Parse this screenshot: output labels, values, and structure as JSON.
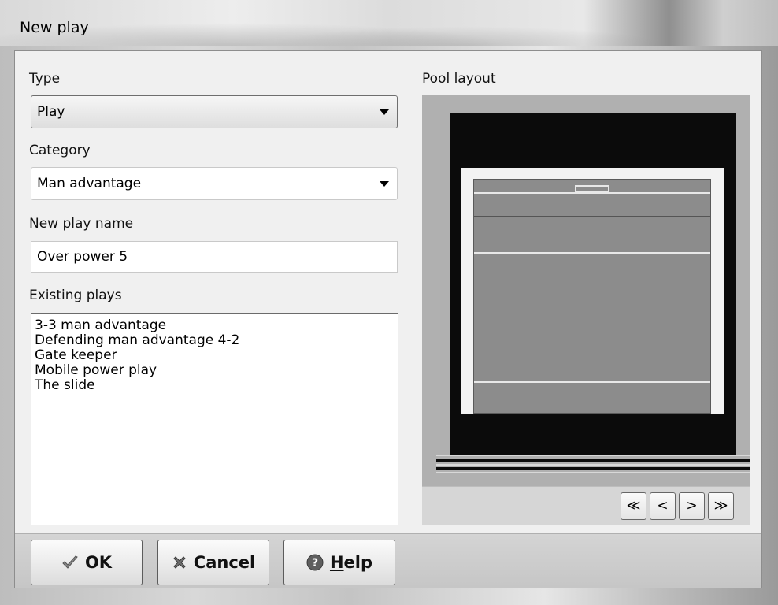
{
  "window": {
    "title": "New play"
  },
  "form": {
    "type_label": "Type",
    "type_value": "Play",
    "category_label": "Category",
    "category_value": "Man advantage",
    "name_label": "New play name",
    "name_value": "Over power 5",
    "existing_label": "Existing plays",
    "existing_items": [
      "3-3 man advantage",
      "Defending man advantage 4-2",
      "Gate keeper",
      "Mobile power play",
      "The slide"
    ]
  },
  "pool": {
    "label": "Pool layout",
    "nav": {
      "first": "≪",
      "prev": "<",
      "next": ">",
      "last": "≫"
    }
  },
  "buttons": {
    "ok": "OK",
    "cancel": "Cancel",
    "help_mnemonic": "H",
    "help_rest": "elp"
  },
  "icons": {
    "ok": "checkmark-icon",
    "cancel": "x-cross-icon",
    "help": "question-mark-icon",
    "dropdown": "dropdown-arrow-icon"
  }
}
